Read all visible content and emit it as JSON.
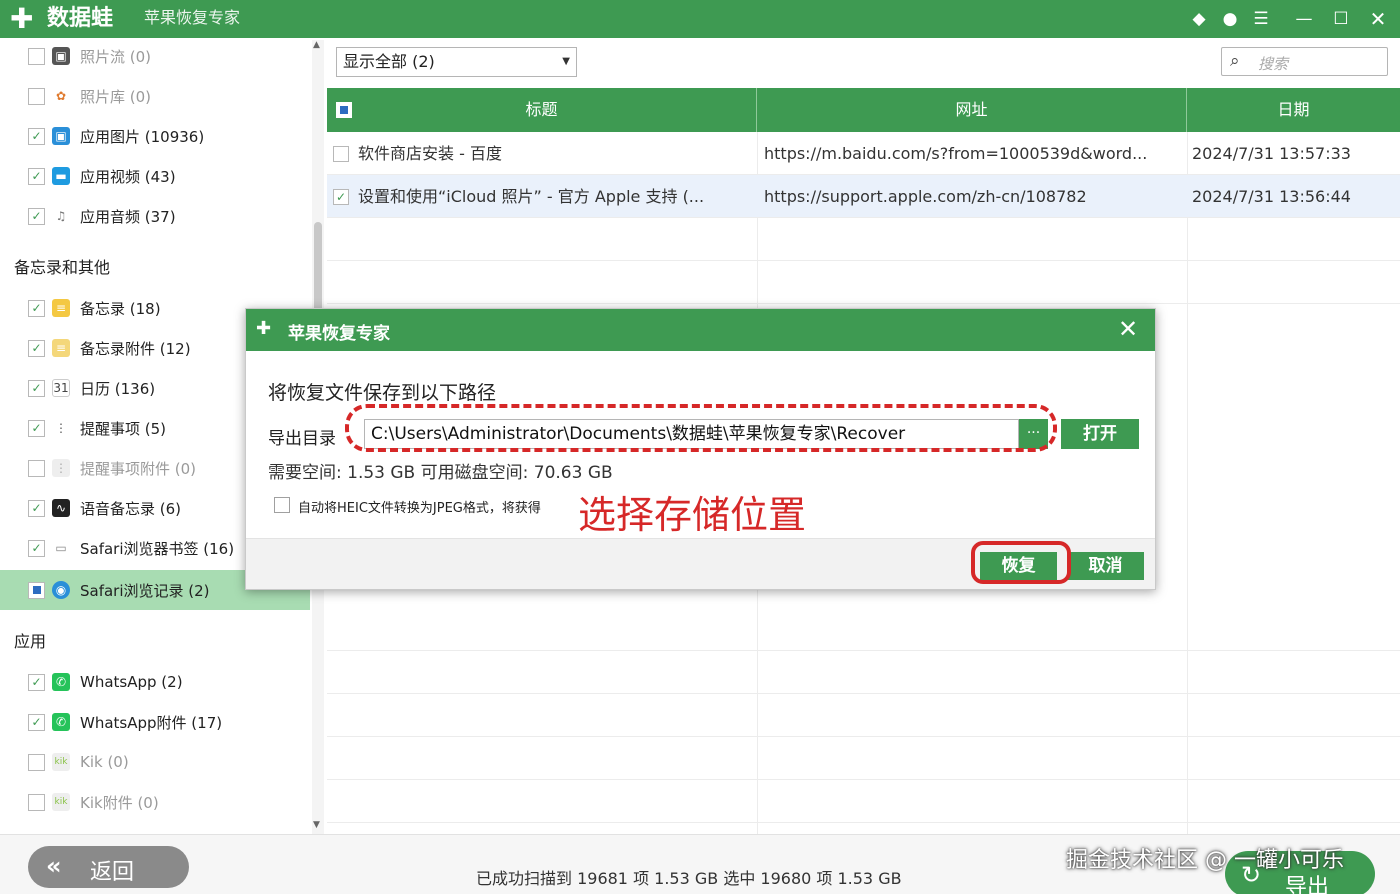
{
  "titlebar": {
    "logo": "数据蛙",
    "title": "苹果恢复专家",
    "icons": [
      "diamond-icon",
      "chat-icon",
      "menu-icon",
      "minimize-icon",
      "maximize-icon",
      "close-icon"
    ]
  },
  "sidebar": {
    "items_top": [
      {
        "label": "照片流 (0)",
        "checked": false,
        "dim": true
      },
      {
        "label": "照片库 (0)",
        "checked": false,
        "dim": true
      },
      {
        "label": "应用图片 (10936)",
        "checked": true,
        "dim": false
      },
      {
        "label": "应用视频 (43)",
        "checked": true,
        "dim": false
      },
      {
        "label": "应用音频 (37)",
        "checked": true,
        "dim": false
      }
    ],
    "section_notes": "备忘录和其他",
    "items_notes": [
      {
        "label": "备忘录 (18)",
        "checked": true,
        "dim": false
      },
      {
        "label": "备忘录附件 (12)",
        "checked": true,
        "dim": false
      },
      {
        "label": "日历 (136)",
        "checked": true,
        "dim": false
      },
      {
        "label": "提醒事项 (5)",
        "checked": true,
        "dim": false
      },
      {
        "label": "提醒事项附件 (0)",
        "checked": false,
        "dim": true
      },
      {
        "label": "语音备忘录 (6)",
        "checked": true,
        "dim": false
      },
      {
        "label": "Safari浏览器书签 (16)",
        "checked": true,
        "dim": false
      },
      {
        "label": "Safari浏览记录 (2)",
        "checked": "partial",
        "dim": false,
        "selected": true
      }
    ],
    "section_apps": "应用",
    "items_apps": [
      {
        "label": "WhatsApp (2)",
        "checked": true,
        "dim": false
      },
      {
        "label": "WhatsApp附件 (17)",
        "checked": true,
        "dim": false
      },
      {
        "label": "Kik (0)",
        "checked": false,
        "dim": true
      },
      {
        "label": "Kik附件 (0)",
        "checked": false,
        "dim": true
      }
    ]
  },
  "toolbar": {
    "filter": "显示全部 (2)",
    "search_placeholder": "搜索"
  },
  "table": {
    "columns": [
      "标题",
      "网址",
      "日期"
    ],
    "rows": [
      {
        "checked": false,
        "title": "软件商店安装 - 百度",
        "url": "https://m.baidu.com/s?from=1000539d&word...",
        "date": "2024/7/31 13:57:33"
      },
      {
        "checked": true,
        "title": "设置和使用“iCloud 照片” - 官方 Apple 支持 (...",
        "url": "https://support.apple.com/zh-cn/108782",
        "date": "2024/7/31 13:56:44"
      }
    ]
  },
  "dialog": {
    "title": "苹果恢复专家",
    "heading": "将恢复文件保存到以下路径",
    "export_label": "导出目录",
    "path": "C:\\Users\\Administrator\\Documents\\数据蛙\\苹果恢复专家\\Recover",
    "browse_label": "···",
    "open_label": "打开",
    "space_text": "需要空间:  1.53 GB    可用磁盘空间:  70.63 GB",
    "heic_label": "自动将HEIC文件转换为JPEG格式，将获得",
    "restore_label": "恢复",
    "cancel_label": "取消"
  },
  "annotation": {
    "text": "选择存储位置"
  },
  "statusbar": {
    "back_label": "返回",
    "status": "已成功扫描到 19681 项 1.53 GB   选中 19680 项 1.53 GB",
    "export_label": "导出"
  },
  "watermark": "掘金技术社区 @ 一罐小可乐"
}
